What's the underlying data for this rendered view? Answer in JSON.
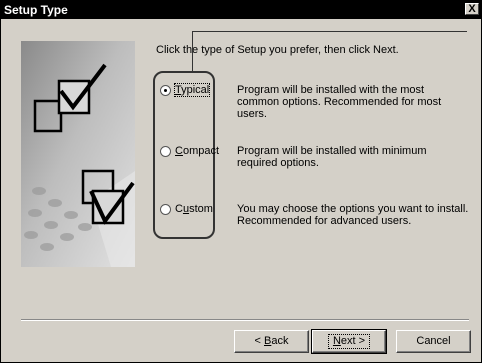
{
  "window": {
    "title": "Setup Type",
    "close_label": "X"
  },
  "instruction": "Click the type of Setup you prefer, then click Next.",
  "options": [
    {
      "label": "Typical",
      "accel": "T",
      "rest": "ypical",
      "selected": true,
      "desc": "Program will be installed with the most common options.  Recommended for most users."
    },
    {
      "label": "Compact",
      "accel": "C",
      "rest": "ompact",
      "selected": false,
      "desc": "Program will be installed with minimum required options."
    },
    {
      "label": "Custom",
      "accel": "u",
      "pre": "C",
      "rest": "stom",
      "selected": false,
      "desc": "You may choose the options you want to install. Recommended for advanced users."
    }
  ],
  "buttons": {
    "back": {
      "label": "< Back",
      "pre": "< ",
      "accel": "B",
      "rest": "ack"
    },
    "next": {
      "label": "Next >",
      "accel": "N",
      "rest": "ext >"
    },
    "cancel": {
      "label": "Cancel"
    }
  }
}
